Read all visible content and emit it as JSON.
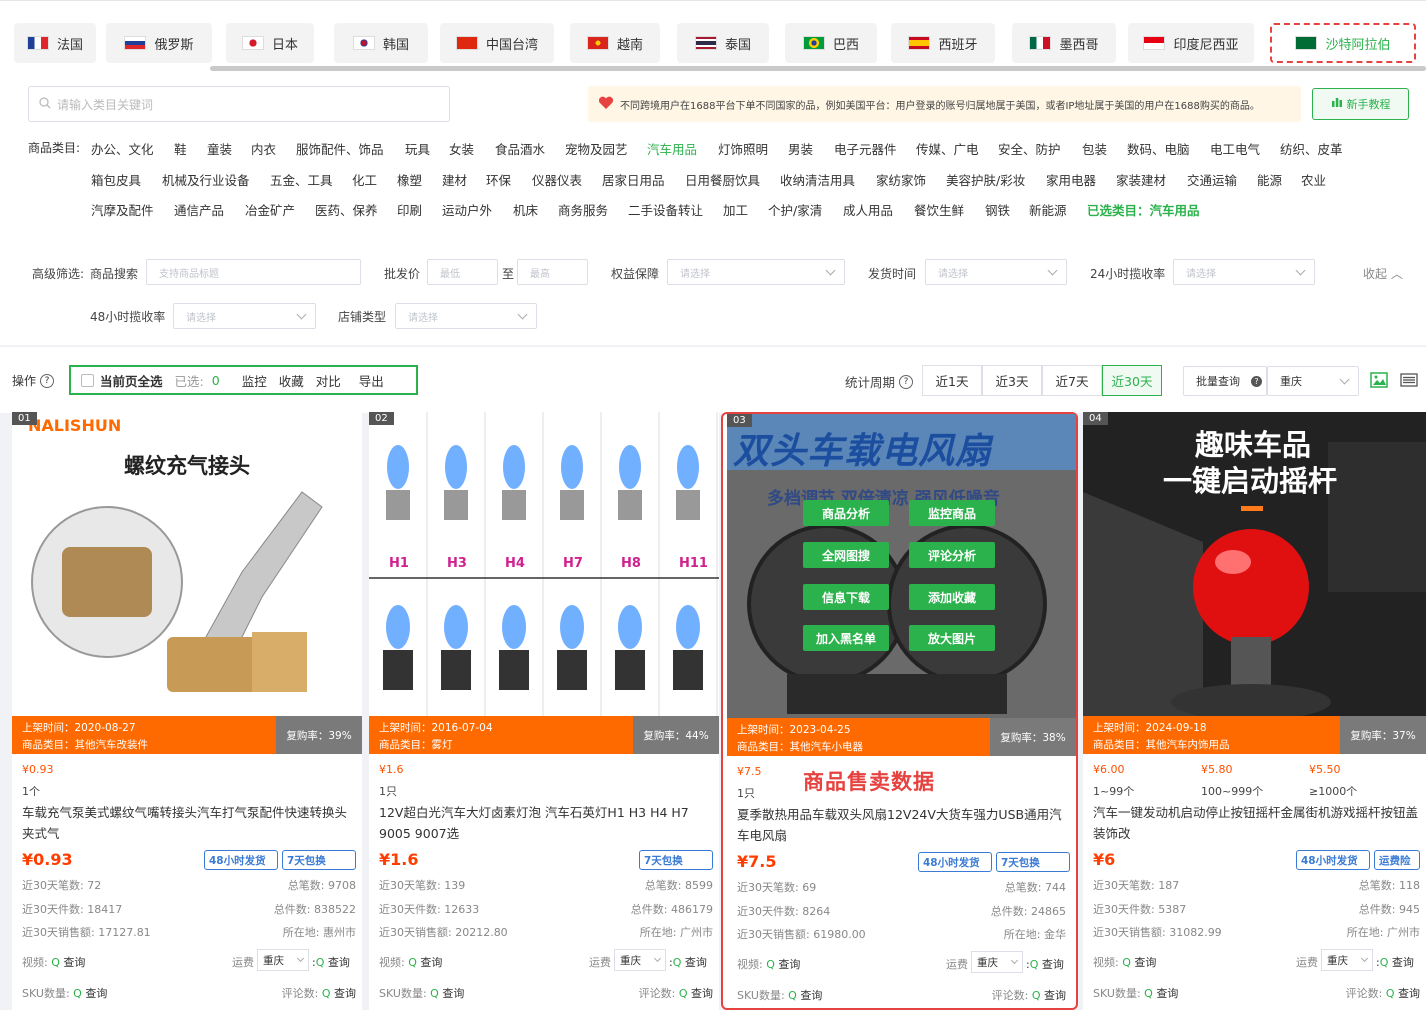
{
  "countries": [
    {
      "label": "法国",
      "flag": "fr"
    },
    {
      "label": "俄罗斯",
      "flag": "ru"
    },
    {
      "label": "日本",
      "flag": "jp"
    },
    {
      "label": "韩国",
      "flag": "kr"
    },
    {
      "label": "中国台湾",
      "flag": "tw"
    },
    {
      "label": "越南",
      "flag": "vn"
    },
    {
      "label": "泰国",
      "flag": "th"
    },
    {
      "label": "巴西",
      "flag": "br"
    },
    {
      "label": "西班牙",
      "flag": "es"
    },
    {
      "label": "墨西哥",
      "flag": "mx"
    },
    {
      "label": "印度尼西亚",
      "flag": "id"
    },
    {
      "label": "沙特阿拉伯",
      "flag": "sa",
      "active": true
    }
  ],
  "search": {
    "placeholder": "请输入类目关键词"
  },
  "notice": {
    "text": "不同跨境用户在1688平台下单不同国家的品，例如美国平台：用户登录的账号归属地属于美国，或者IP地址属于美国的用户在1688购买的商品。"
  },
  "tutorial_label": "新手教程",
  "category_label": "商品类目:",
  "categories_row1": [
    "办公、文化",
    "鞋",
    "童装",
    "内衣",
    "服饰配件、饰品",
    "玩具",
    "女装",
    "食品酒水",
    "宠物及园艺",
    "汽车用品",
    "灯饰照明",
    "男装",
    "电子元器件",
    "传媒、广电",
    "安全、防护",
    "包装",
    "数码、电脑",
    "电工电气",
    "纺织、皮革"
  ],
  "categories_row2": [
    "箱包皮具",
    "机械及行业设备",
    "五金、工具",
    "化工",
    "橡塑",
    "建材",
    "环保",
    "仪器仪表",
    "居家日用品",
    "日用餐厨饮具",
    "收纳清洁用具",
    "家纺家饰",
    "美容护肤/彩妆",
    "家用电器",
    "家装建材",
    "交通运输",
    "能源",
    "农业"
  ],
  "categories_row3": [
    "汽摩及配件",
    "通信产品",
    "冶金矿产",
    "医药、保养",
    "印刷",
    "运动户外",
    "机床",
    "商务服务",
    "二手设备转让",
    "加工",
    "个护/家清",
    "成人用品",
    "餐饮生鲜",
    "钢铁",
    "新能源"
  ],
  "selected_category": "已选类目：汽车用品",
  "filters": {
    "advanced_label": "高级筛选:",
    "product_search_label": "商品搜索",
    "product_search_placeholder": "支持商品标题",
    "wholesale_label": "批发价",
    "min_placeholder": "最低",
    "to": "至",
    "max_placeholder": "最高",
    "rights_label": "权益保障",
    "ship_time_label": "发货时间",
    "rate24_label": "24小时揽收率",
    "rate48_label": "48小时揽收率",
    "shop_type_label": "店铺类型",
    "select_placeholder": "请选择",
    "collapse": "收起"
  },
  "ops": {
    "label": "操作",
    "select_page": "当前页全选",
    "selected_label": "已选:",
    "selected_count": "0",
    "monitor": "监控",
    "favorite": "收藏",
    "compare": "对比",
    "export": "导出",
    "period_label": "统计周期",
    "periods": [
      "近1天",
      "近3天",
      "近7天",
      "近30天"
    ],
    "batch_query": "批量查询",
    "city": "重庆"
  },
  "cards": [
    {
      "idx": "01",
      "brand": "NALISHUN",
      "img_title": "螺纹充气接头",
      "list_time": "上架时间：2020-08-27",
      "category": "商品类目：其他汽车改装件",
      "rebuy": "复购率：39%",
      "tiers": [
        {
          "price": "¥0.93",
          "qty": "1个"
        }
      ],
      "title": "车载充气泵美式螺纹气嘴转接头汽车打气泵配件快速转换头夹式气",
      "price": "¥0.93",
      "tags": [
        "48小时发货",
        "7天包换"
      ],
      "orders30": "近30天笔数: 72",
      "orders_total": "总笔数: 9708",
      "pieces30": "近30天件数: 18417",
      "pieces_total": "总件数: 838522",
      "sales30": "近30天销售额: 17127.81",
      "location": "所在地: 惠州市",
      "video": "视频:",
      "freight": "运费",
      "city": "重庆",
      "sku": "SKU数量:",
      "reviews": "评论数:",
      "query": "查询"
    },
    {
      "idx": "02",
      "bulbs": [
        "H1",
        "H3",
        "H4",
        "H7",
        "H8",
        "H11"
      ],
      "list_time": "上架时间：2016-07-04",
      "category": "商品类目：雾灯",
      "rebuy": "复购率：44%",
      "tiers": [
        {
          "price": "¥1.6",
          "qty": "1只"
        }
      ],
      "title": "12V超白光汽车大灯卤素灯泡 汽车石英灯H1 H3 H4 H7 9005 9007选",
      "price": "¥1.6",
      "tags": [
        "7天包换"
      ],
      "orders30": "近30天笔数: 139",
      "orders_total": "总笔数: 8599",
      "pieces30": "近30天件数: 12633",
      "pieces_total": "总件数: 486179",
      "sales30": "近30天销售额: 20212.80",
      "location": "所在地: 广州市",
      "video": "视频:",
      "freight": "运费",
      "city": "重庆",
      "sku": "SKU数量:",
      "reviews": "评论数:",
      "query": "查询"
    },
    {
      "idx": "03",
      "img_title": "双头车载电风扇",
      "img_sub": "多档调节 双倍清凉 强风低噪音",
      "overlay": [
        "商品分析",
        "监控商品",
        "全网图搜",
        "评论分析",
        "信息下载",
        "添加收藏",
        "加入黑名单",
        "放大图片"
      ],
      "sale_label": "商品售卖数据",
      "list_time": "上架时间：2023-04-25",
      "category": "商品类目：其他汽车小电器",
      "rebuy": "复购率：38%",
      "tiers": [
        {
          "price": "¥7.5",
          "qty": "1只"
        }
      ],
      "title": "夏季散热用品车载双头风扇12V24V大货车强力USB通用汽车电风扇",
      "price": "¥7.5",
      "tags": [
        "48小时发货",
        "7天包换"
      ],
      "orders30": "近30天笔数: 69",
      "orders_total": "总笔数: 744",
      "pieces30": "近30天件数: 8264",
      "pieces_total": "总件数: 24865",
      "sales30": "近30天销售额: 61980.00",
      "location": "所在地: 金华",
      "video": "视频:",
      "freight": "运费",
      "city": "重庆",
      "sku": "SKU数量:",
      "reviews": "评论数:",
      "query": "查询"
    },
    {
      "idx": "04",
      "img_title": "趣味车品",
      "img_sub": "一键启动摇杆",
      "list_time": "上架时间：2024-09-18",
      "category": "商品类目：其他汽车内饰用品",
      "rebuy": "复购率：37%",
      "tiers": [
        {
          "price": "¥6.00",
          "qty": "1~99个"
        },
        {
          "price": "¥5.80",
          "qty": "100~999个"
        },
        {
          "price": "¥5.50",
          "qty": "≥1000个"
        }
      ],
      "title": "汽车一键发动机启动停止按钮摇杆金属街机游戏摇杆按钮盖装饰改",
      "price": "¥6",
      "tags": [
        "48小时发货",
        "运费险"
      ],
      "orders30": "近30天笔数: 187",
      "orders_total": "总笔数: 118",
      "pieces30": "近30天件数: 5387",
      "pieces_total": "总件数: 945",
      "sales30": "近30天销售额: 31082.99",
      "location": "所在地: 广州市",
      "video": "视频:",
      "freight": "运费",
      "city": "重庆",
      "sku": "SKU数量:",
      "reviews": "评论数:",
      "query": "查询"
    }
  ],
  "colors": {
    "accent": "#2bb24c",
    "highlight": "#e64340",
    "orange": "#ff6a00",
    "price": "#ff3d00"
  }
}
